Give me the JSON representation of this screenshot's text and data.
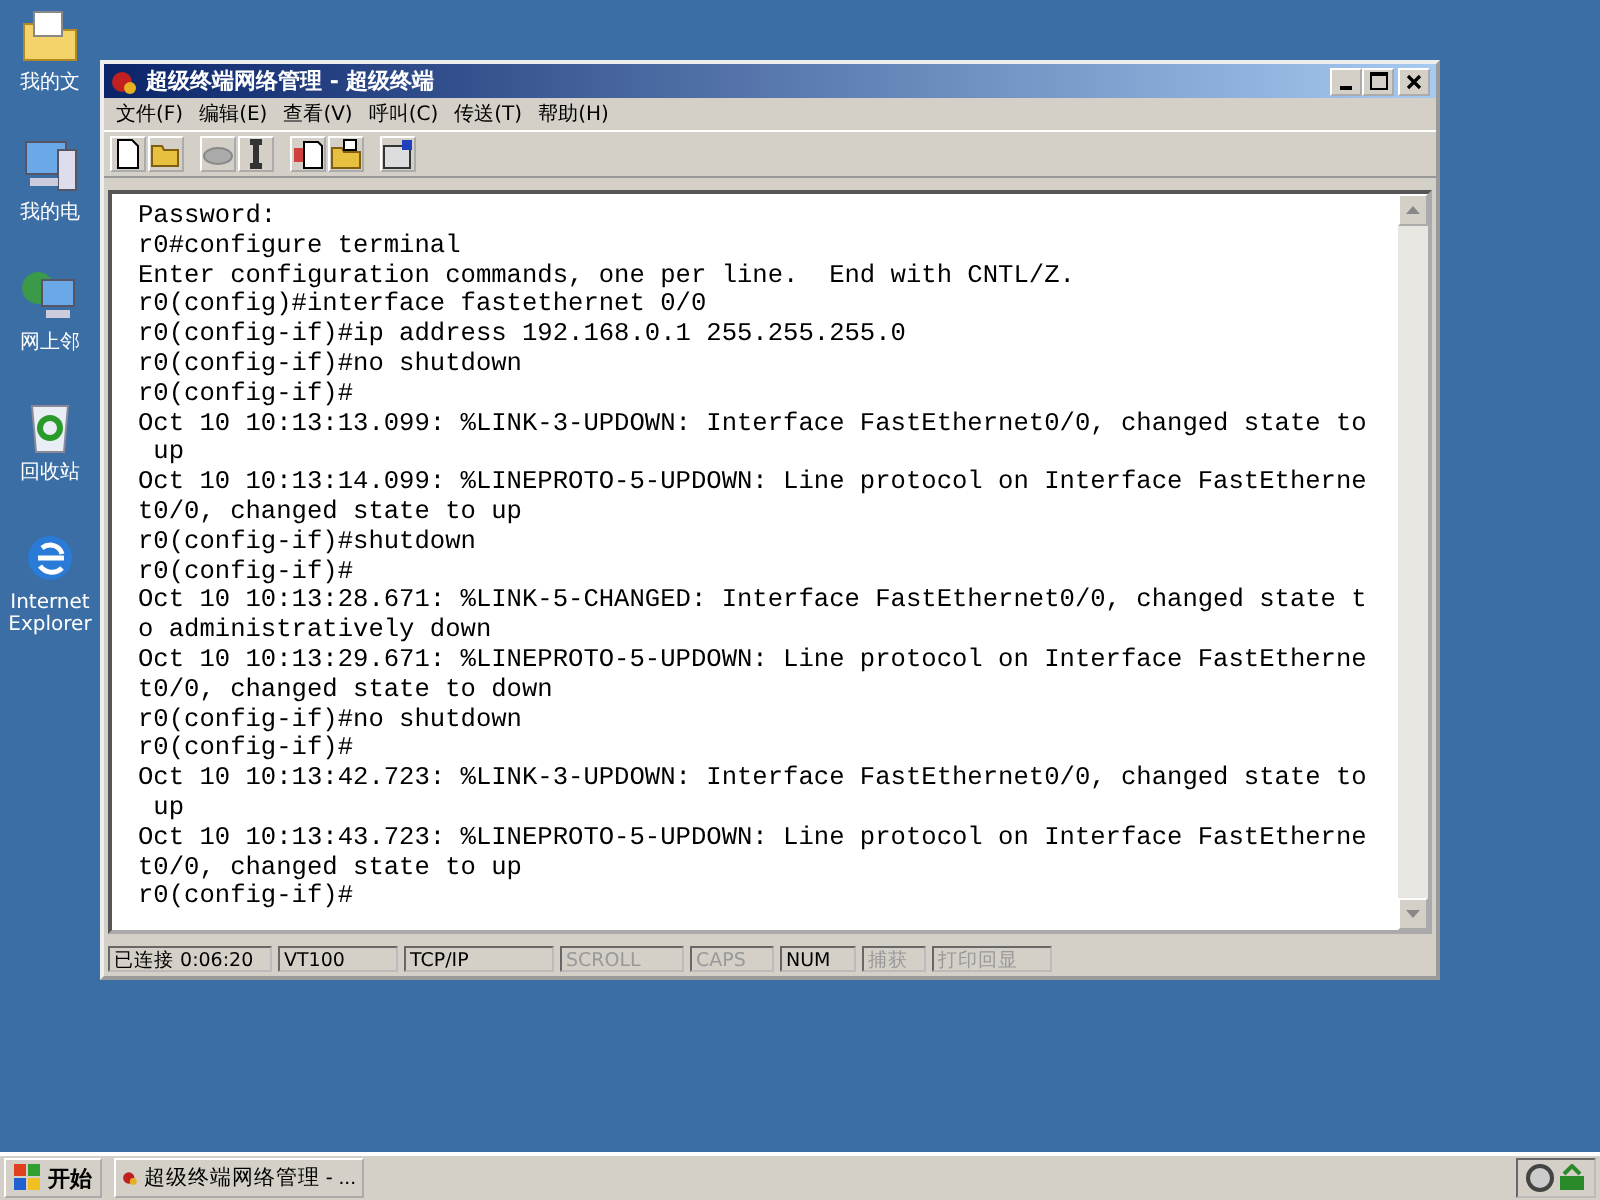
{
  "desktop_icons": [
    {
      "kind": "folder",
      "label": "我的文"
    },
    {
      "kind": "computer",
      "label": "我的电"
    },
    {
      "kind": "network",
      "label": "网上邻"
    },
    {
      "kind": "recycle",
      "label": "回收站"
    },
    {
      "kind": "browser",
      "label": "Internet Explorer"
    }
  ],
  "window": {
    "title": "超级终端网络管理 - 超级终端"
  },
  "menu": [
    "文件(F)",
    "编辑(E)",
    "查看(V)",
    "呼叫(C)",
    "传送(T)",
    "帮助(H)"
  ],
  "terminal_lines": [
    "Password:",
    "r0#configure terminal",
    "Enter configuration commands, one per line.  End with CNTL/Z.",
    "r0(config)#interface fastethernet 0/0",
    "r0(config-if)#ip address 192.168.0.1 255.255.255.0",
    "r0(config-if)#no shutdown",
    "r0(config-if)#",
    "Oct 10 10:13:13.099: %LINK-3-UPDOWN: Interface FastEthernet0/0, changed state to",
    " up",
    "Oct 10 10:13:14.099: %LINEPROTO-5-UPDOWN: Line protocol on Interface FastEtherne",
    "t0/0, changed state to up",
    "r0(config-if)#shutdown",
    "r0(config-if)#",
    "Oct 10 10:13:28.671: %LINK-5-CHANGED: Interface FastEthernet0/0, changed state t",
    "o administratively down",
    "Oct 10 10:13:29.671: %LINEPROTO-5-UPDOWN: Line protocol on Interface FastEtherne",
    "t0/0, changed state to down",
    "r0(config-if)#no shutdown",
    "r0(config-if)#",
    "Oct 10 10:13:42.723: %LINK-3-UPDOWN: Interface FastEthernet0/0, changed state to",
    " up",
    "Oct 10 10:13:43.723: %LINEPROTO-5-UPDOWN: Line protocol on Interface FastEtherne",
    "t0/0, changed state to up",
    "r0(config-if)#"
  ],
  "status_bar": [
    {
      "text": "已连接 0:06:20",
      "active": true
    },
    {
      "text": "VT100",
      "active": true
    },
    {
      "text": "TCP/IP",
      "active": true
    },
    {
      "text": "SCROLL",
      "active": false
    },
    {
      "text": "CAPS",
      "active": false
    },
    {
      "text": "NUM",
      "active": true
    },
    {
      "text": "捕获",
      "active": false
    },
    {
      "text": "打印回显",
      "active": false
    }
  ],
  "taskbar": {
    "start": "开始",
    "task": "超级终端网络管理 - ..."
  }
}
